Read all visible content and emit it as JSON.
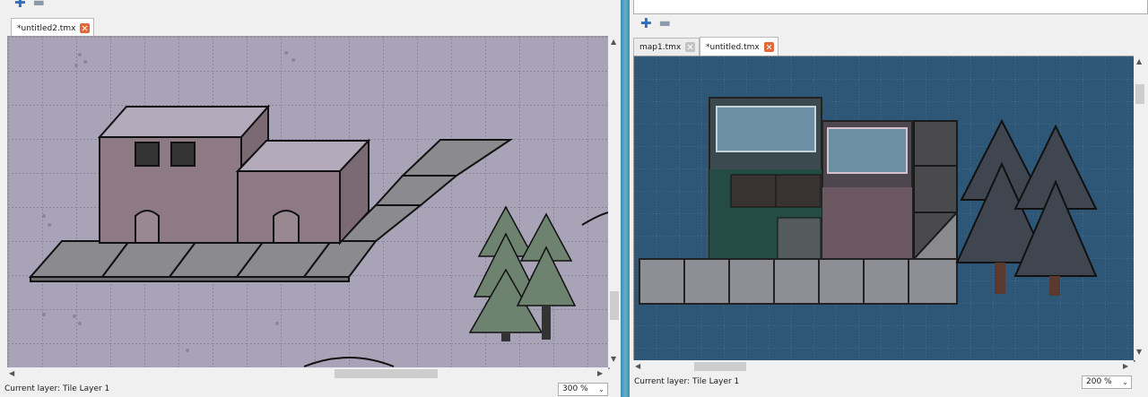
{
  "left": {
    "tabs": [
      {
        "label": "*untitled2.tmx",
        "active": true
      }
    ],
    "status": "Current layer: Tile Layer 1",
    "zoom": "300 %"
  },
  "right": {
    "tabs": [
      {
        "label": "map1.tmx",
        "active": false
      },
      {
        "label": "*untitled.tmx",
        "active": true
      }
    ],
    "status": "Current layer: Tile Layer 1",
    "zoom": "200 %"
  },
  "icons": {
    "add": "plus-icon",
    "remove": "minus-icon",
    "close": "close-icon"
  },
  "colors": {
    "left_canvas": "#a9a3b8",
    "right_canvas": "#2e5677",
    "tab_close": "#e2673b"
  }
}
